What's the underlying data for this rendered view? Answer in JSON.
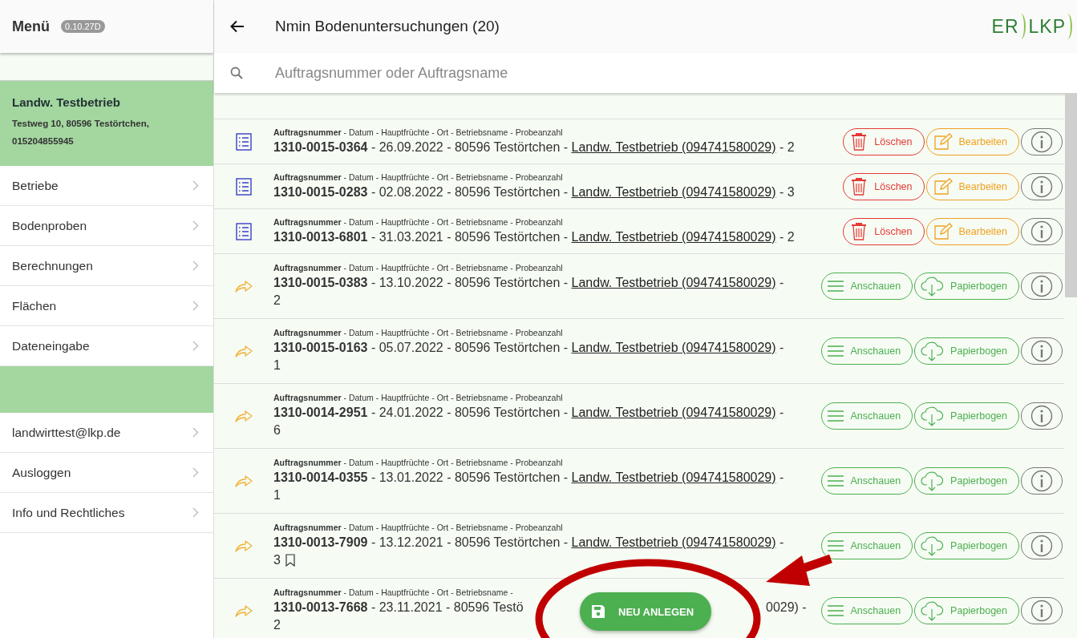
{
  "sidebar": {
    "title": "Menü",
    "version": "0.10.27D",
    "account": {
      "name": "Landw. Testbetrieb",
      "address": "Testweg 10, 80596 Testörtchen,",
      "phone": "015204855945"
    },
    "items": [
      {
        "label": "Betriebe"
      },
      {
        "label": "Bodenproben"
      },
      {
        "label": "Berechnungen"
      },
      {
        "label": "Flächen"
      },
      {
        "label": "Dateneingabe"
      }
    ],
    "account_items": [
      {
        "label": "landwirttest@lkp.de"
      },
      {
        "label": "Ausloggen"
      },
      {
        "label": "Info und Rechtliches"
      }
    ]
  },
  "header": {
    "title": "Nmin Bodenuntersuchungen (20)",
    "logo_left": "ER",
    "logo_right": "LKP"
  },
  "search": {
    "placeholder": "Auftragsnummer oder Auftragsname"
  },
  "orders": [
    {
      "kind": "draft",
      "caption": "**Auftragsnummer** - Datum - Hauptfrüchte - Ort - Betriebsname - Probeanzahl",
      "summary": "**1310-0015-0364** - 26.09.2022 - 80596 Testörtchen - ",
      "company": "Landw. Testbetrieb (094741580029)",
      "tail": " - 2",
      "bookmark": false,
      "actions": [
        {
          "kind": "delete",
          "label": "Löschen"
        },
        {
          "kind": "edit",
          "label": "Bearbeiten"
        },
        {
          "kind": "info"
        }
      ]
    },
    {
      "kind": "draft",
      "caption": "**Auftragsnummer** - Datum - Hauptfrüchte - Ort - Betriebsname - Probeanzahl",
      "summary": "**1310-0015-0283** - 02.08.2022 - 80596 Testörtchen - ",
      "company": "Landw. Testbetrieb (094741580029)",
      "tail": " - 3",
      "bookmark": false,
      "actions": [
        {
          "kind": "delete",
          "label": "Löschen"
        },
        {
          "kind": "edit",
          "label": "Bearbeiten"
        },
        {
          "kind": "info"
        }
      ]
    },
    {
      "kind": "draft",
      "caption": "**Auftragsnummer** - Datum - Hauptfrüchte - Ort - Betriebsname - Probeanzahl",
      "summary": "**1310-0013-6801** - 31.03.2021 - 80596 Testörtchen - ",
      "company": "Landw. Testbetrieb (094741580029)",
      "tail": " - 2",
      "bookmark": false,
      "actions": [
        {
          "kind": "delete",
          "label": "Löschen"
        },
        {
          "kind": "edit",
          "label": "Bearbeiten"
        },
        {
          "kind": "info"
        }
      ]
    },
    {
      "kind": "sent",
      "caption": "**Auftragsnummer** - Datum - Hauptfrüchte - Ort - Betriebsname - Probeanzahl",
      "summary": "**1310-0015-0383** - 13.10.2022 - 80596 Testörtchen - ",
      "company": "Landw. Testbetrieb (094741580029)",
      "tail": " - 2",
      "bookmark": false,
      "actions": [
        {
          "kind": "view",
          "label": "Anschauen"
        },
        {
          "kind": "paper",
          "label": "Papierbogen"
        },
        {
          "kind": "info"
        }
      ]
    },
    {
      "kind": "sent",
      "caption": "**Auftragsnummer** - Datum - Hauptfrüchte - Ort - Betriebsname - Probeanzahl",
      "summary": "**1310-0015-0163** - 05.07.2022 - 80596 Testörtchen - ",
      "company": "Landw. Testbetrieb (094741580029)",
      "tail": " - 1",
      "bookmark": false,
      "actions": [
        {
          "kind": "view",
          "label": "Anschauen"
        },
        {
          "kind": "paper",
          "label": "Papierbogen"
        },
        {
          "kind": "info"
        }
      ]
    },
    {
      "kind": "sent",
      "caption": "**Auftragsnummer** - Datum - Hauptfrüchte - Ort - Betriebsname - Probeanzahl",
      "summary": "**1310-0014-2951** - 24.01.2022 - 80596 Testörtchen - ",
      "company": "Landw. Testbetrieb (094741580029)",
      "tail": " - 6",
      "bookmark": false,
      "actions": [
        {
          "kind": "view",
          "label": "Anschauen"
        },
        {
          "kind": "paper",
          "label": "Papierbogen"
        },
        {
          "kind": "info"
        }
      ]
    },
    {
      "kind": "sent",
      "caption": "**Auftragsnummer** - Datum - Hauptfrüchte - Ort - Betriebsname - Probeanzahl",
      "summary": "**1310-0014-0355** - 13.01.2022 - 80596 Testörtchen - ",
      "company": "Landw. Testbetrieb (094741580029)",
      "tail": " - 1",
      "bookmark": false,
      "actions": [
        {
          "kind": "view",
          "label": "Anschauen"
        },
        {
          "kind": "paper",
          "label": "Papierbogen"
        },
        {
          "kind": "info"
        }
      ]
    },
    {
      "kind": "sent",
      "caption": "**Auftragsnummer** - Datum - Hauptfrüchte - Ort - Betriebsname - Probeanzahl",
      "summary": "**1310-0013-7909** - 13.12.2021 - 80596 Testörtchen - ",
      "company": "Landw. Testbetrieb (094741580029)",
      "tail": " - 3",
      "bookmark": true,
      "actions": [
        {
          "kind": "view",
          "label": "Anschauen"
        },
        {
          "kind": "paper",
          "label": "Papierbogen"
        },
        {
          "kind": "info"
        }
      ]
    },
    {
      "kind": "sent",
      "caption": "**Auftragsnummer** - Datum - Hauptfrüchte - Ort - Betriebsname -",
      "summary": "**1310-0013-7668** - 23.11.2021 - 80596 Testö",
      "after": "0029) -",
      "tail": "2",
      "bookmark": false,
      "actions": [
        {
          "kind": "view",
          "label": "Anschauen"
        },
        {
          "kind": "paper",
          "label": "Papierbogen"
        },
        {
          "kind": "info"
        }
      ]
    }
  ],
  "fab": {
    "label": "NEU ANLEGEN"
  }
}
